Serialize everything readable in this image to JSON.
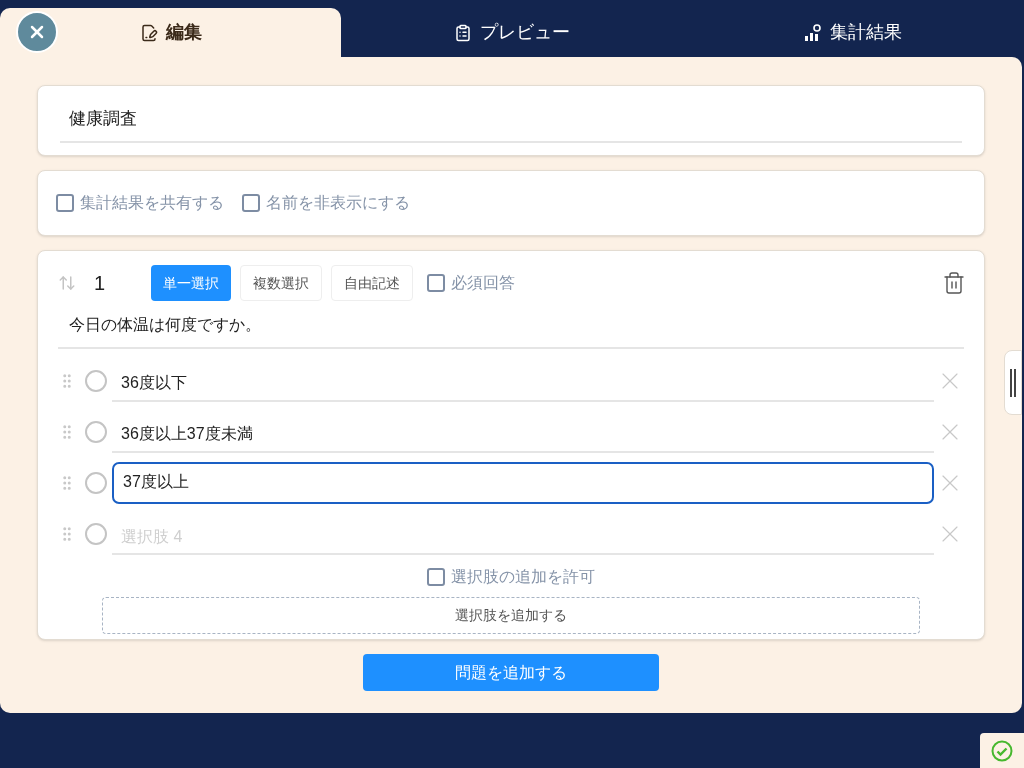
{
  "tabs": [
    {
      "label": "編集",
      "selected": true
    },
    {
      "label": "プレビュー",
      "selected": false
    },
    {
      "label": "集計結果",
      "selected": false
    }
  ],
  "survey_title": {
    "value": "健康調査"
  },
  "settings": [
    {
      "label": "集計結果を共有する",
      "checked": false
    },
    {
      "label": "名前を非表示にする",
      "checked": false
    }
  ],
  "question": {
    "number": "1",
    "types": [
      {
        "label": "単一選択",
        "selected": true
      },
      {
        "label": "複数選択",
        "selected": false
      },
      {
        "label": "自由記述",
        "selected": false
      }
    ],
    "required": {
      "label": "必須回答",
      "checked": false
    },
    "text": "今日の体温は何度ですか。",
    "options": [
      {
        "value": "36度以下",
        "selected": false,
        "focused": false
      },
      {
        "value": "36度以上37度未満",
        "selected": false,
        "focused": false
      },
      {
        "value": "37度以上",
        "selected": false,
        "focused": true
      },
      {
        "placeholder": "選択肢 4",
        "selected": false,
        "focused": false
      }
    ],
    "allow_add": {
      "label": "選択肢の追加を許可",
      "checked": false
    },
    "add_option": "選択肢を追加する"
  },
  "add_question": "問題を追加する"
}
